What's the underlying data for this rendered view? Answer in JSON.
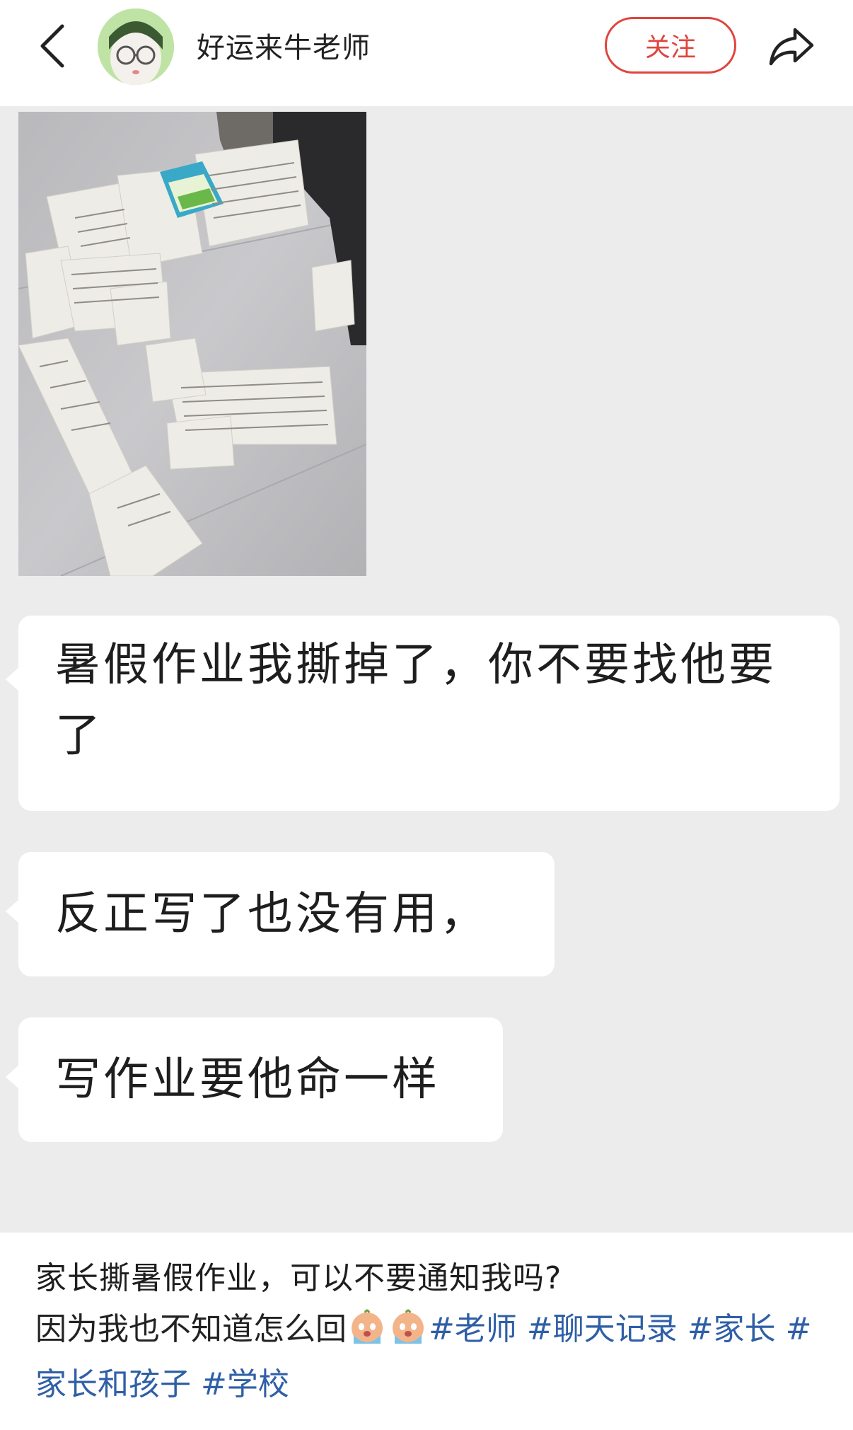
{
  "header": {
    "author_name": "好运来牛老师",
    "follow_label": "关注",
    "back_icon": "back-chevron-icon",
    "share_icon": "share-arrow-icon",
    "accent_color": "#e0443d"
  },
  "chat": {
    "messages": [
      {
        "text": "暑假作业我撕掉了，你不要找他要了"
      },
      {
        "text": "反正写了也没有用，"
      },
      {
        "text": "写作业要他命一样"
      }
    ]
  },
  "post": {
    "title": "家长撕暑假作业，可以不要通知我吗?",
    "body_text": "因为我也不知道怎么回",
    "emoji_icon": "crying-emoji-icon",
    "tags": [
      "#老师",
      "#聊天记录",
      "#家长",
      "#家长和孩子",
      "#学校"
    ],
    "tag_color": "#2f5fa6"
  }
}
